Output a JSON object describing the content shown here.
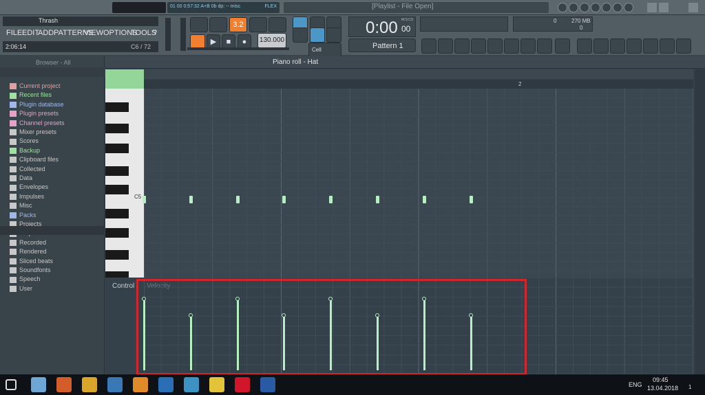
{
  "titlebar": {
    "title": "[Playlist - File Open]",
    "transport_readout": "01  00  0:57:32  A+B 0b  dp: --  misc",
    "key": "FLEX"
  },
  "menu": {
    "items": [
      "FILE",
      "EDIT",
      "ADD",
      "PATTERNS",
      "VIEW",
      "OPTIONS",
      "TOOLS",
      "?"
    ]
  },
  "project": {
    "name": "Thrash",
    "time": "2:06:14",
    "note": "C6 / 72"
  },
  "transport": {
    "tempo": "130.000",
    "time": "0:00",
    "time_small": "00",
    "time_unit": "M:S:CS",
    "pattern": "Pattern 1",
    "snap": "Cell",
    "memory": "270 MB",
    "cpu": "0",
    "poly": "0",
    "play_mode": "3.2"
  },
  "browser": {
    "header": "Browser - All",
    "items": [
      {
        "label": "Current project",
        "color": "#e0a0a0"
      },
      {
        "label": "Recent files",
        "color": "#a0e0a0"
      },
      {
        "label": "Plugin database",
        "color": "#a0b8e8"
      },
      {
        "label": "Plugin presets",
        "color": "#e8a0c8"
      },
      {
        "label": "Channel presets",
        "color": "#e8a0c8"
      },
      {
        "label": "Mixer presets",
        "color": "#c8c8c8"
      },
      {
        "label": "Scores",
        "color": "#c8c8c8"
      },
      {
        "label": "Backup",
        "color": "#a0e0a0"
      },
      {
        "label": "Clipboard files",
        "color": "#c8c8c8"
      },
      {
        "label": "Collected",
        "color": "#c8c8c8"
      },
      {
        "label": "Data",
        "color": "#c8c8c8"
      },
      {
        "label": "Envelopes",
        "color": "#c8c8c8"
      },
      {
        "label": "Impulses",
        "color": "#c8c8c8"
      },
      {
        "label": "Misc",
        "color": "#c8c8c8"
      },
      {
        "label": "Packs",
        "color": "#a0b8e8"
      },
      {
        "label": "Projects",
        "color": "#c8c8c8"
      },
      {
        "label": "Projects bones",
        "color": "#c8c8c8"
      },
      {
        "label": "Recorded",
        "color": "#c8c8c8"
      },
      {
        "label": "Rendered",
        "color": "#c8c8c8"
      },
      {
        "label": "Sliced beats",
        "color": "#c8c8c8"
      },
      {
        "label": "Soundfonts",
        "color": "#c8c8c8"
      },
      {
        "label": "Speech",
        "color": "#c8c8c8"
      },
      {
        "label": "User",
        "color": "#c8c8c8"
      }
    ]
  },
  "pianoroll": {
    "title": "Piano roll - Hat",
    "bar_marker": "2",
    "key_label": "C5",
    "control_label": "Control",
    "velocity_label": "Velocity",
    "velocities": [
      0.96,
      0.74,
      0.96,
      0.74,
      0.96,
      0.74,
      0.96,
      0.74
    ]
  },
  "taskbar": {
    "lang": "ENG",
    "clock": "09:45",
    "date": "13.04.2018",
    "notif": "1"
  },
  "colors": {
    "accent": "#f08030",
    "note": "#b6f0c0",
    "highlight": "#d0262e"
  }
}
